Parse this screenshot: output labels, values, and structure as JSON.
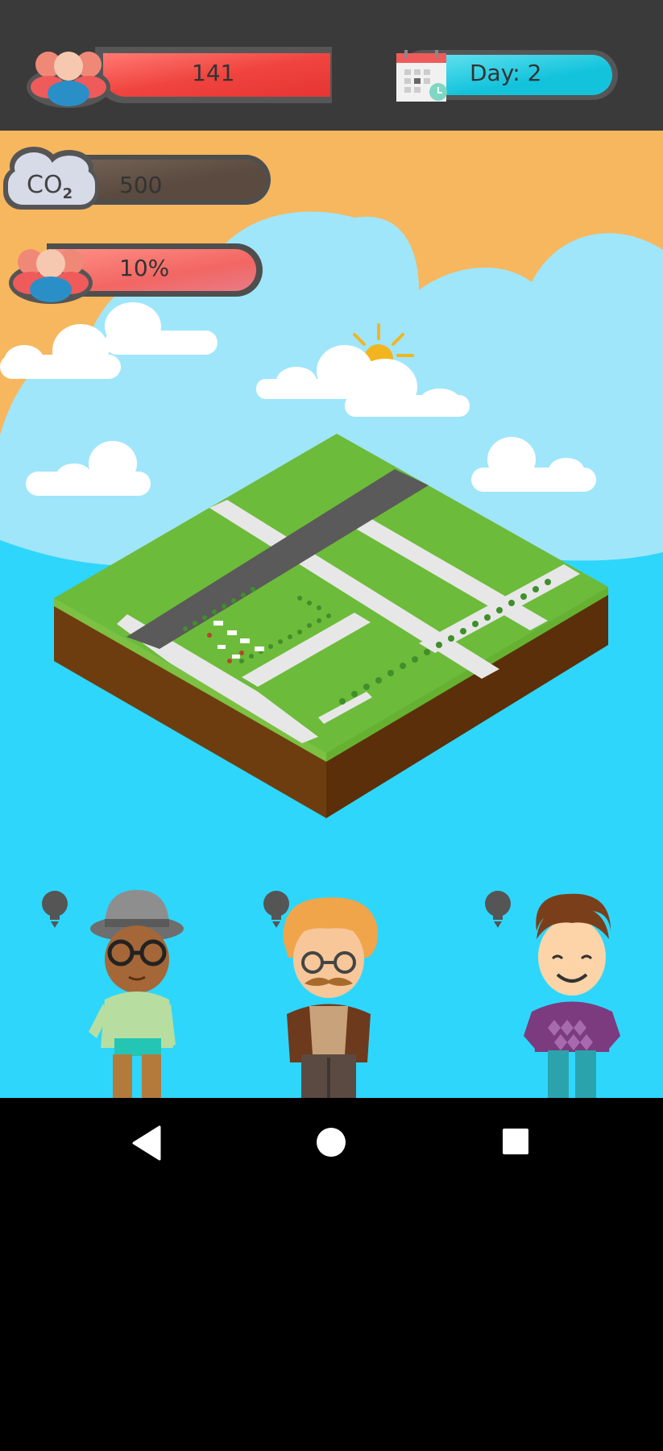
{
  "hud": {
    "population_value": "141",
    "day_label": "Day: 2",
    "co2_label": "CO",
    "co2_subscript": "2",
    "co2_value": "500",
    "happiness_value": "10%",
    "icons": [
      "people-icon",
      "calendar-icon",
      "cloud-co2-icon",
      "people-icon"
    ]
  },
  "colors": {
    "topbar": "#3a3a3a",
    "population_bar": "#f0443f",
    "day_bar": "#13c3dc",
    "co2_bar": "#5a4a3f",
    "happiness_bar": "#f26663",
    "sky": "#9fe6fb",
    "sunset": "#f7b75e",
    "sea": "#2ed6fb"
  },
  "characters": [
    {
      "name": "character-hat-glasses",
      "has_idea_bulb": true
    },
    {
      "name": "character-mustache",
      "has_idea_bulb": true
    },
    {
      "name": "character-sweater",
      "has_idea_bulb": true
    }
  ],
  "navigation": {
    "items": [
      "back-button",
      "home-button",
      "recents-button"
    ]
  }
}
